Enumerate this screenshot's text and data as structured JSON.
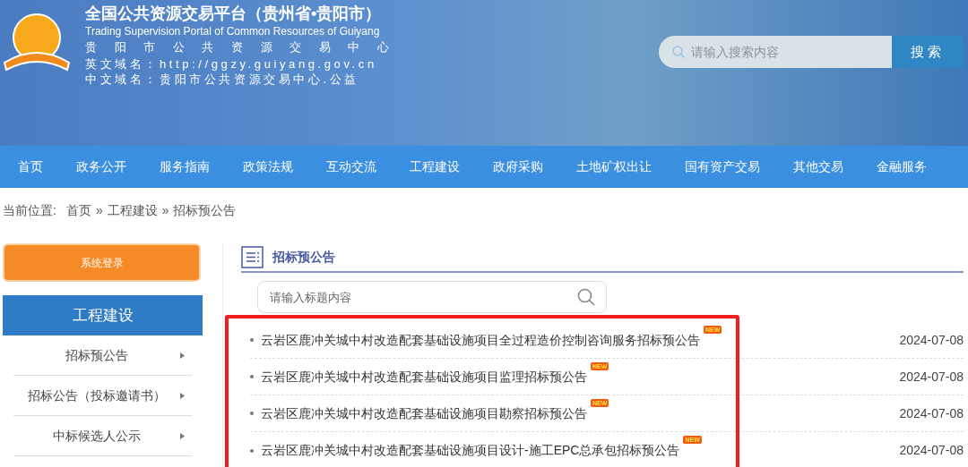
{
  "header": {
    "title": "全国公共资源交易平台（贵州省•贵阳市）",
    "subtitle": "Trading Supervision Portal of Common Resources of Guiyang",
    "center_name": "贵阳市公共资源交易中心",
    "domain_lines": [
      {
        "label": "英文域名：",
        "value": "http://ggzy.guiyang.gov.cn"
      },
      {
        "label": "中文域名：",
        "value": "贵阳市公共资源交易中心.公益"
      }
    ],
    "search": {
      "placeholder": "请输入搜索内容",
      "button": "搜索"
    }
  },
  "nav": [
    "首页",
    "政务公开",
    "服务指南",
    "政策法规",
    "互动交流",
    "工程建设",
    "政府采购",
    "土地矿权出让",
    "国有资产交易",
    "其他交易",
    "金融服务"
  ],
  "breadcrumb": {
    "label": "当前位置:",
    "items": [
      "首页",
      "工程建设",
      "招标预公告"
    ],
    "separator": "»"
  },
  "sidebar": {
    "login_button": "系统登录",
    "category": "工程建设",
    "items": [
      "招标预公告",
      "招标公告（投标邀请书）",
      "中标候选人公示"
    ]
  },
  "content": {
    "title": "招标预公告",
    "search": {
      "placeholder": "请输入标题内容"
    },
    "highlighted": true,
    "rows": [
      {
        "title": "云岩区鹿冲关城中村改造配套基础设施项目全过程造价控制咨询服务招标预公告",
        "badge": "NEW",
        "date": "2024-07-08"
      },
      {
        "title": "云岩区鹿冲关城中村改造配套基础设施项目监理招标预公告",
        "badge": "NEW",
        "date": "2024-07-08"
      },
      {
        "title": "云岩区鹿冲关城中村改造配套基础设施项目勘察招标预公告",
        "badge": "NEW",
        "date": "2024-07-08"
      },
      {
        "title": "云岩区鹿冲关城中村改造配套基础设施项目设计-施工EPC总承包招标预公告",
        "badge": "NEW",
        "date": "2024-07-08"
      }
    ]
  }
}
